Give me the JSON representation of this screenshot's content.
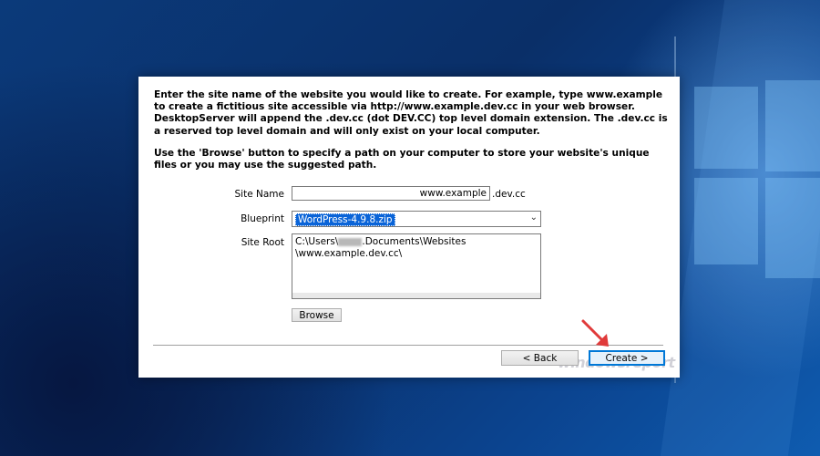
{
  "dialog": {
    "intro_paragraph": "Enter the site name of the website you would like to create. For example, type www.example to create a fictitious site accessible via http://www.example.dev.cc in your web browser. DesktopServer will append the .dev.cc (dot DEV.CC) top level domain extension. The .dev.cc is a reserved top level domain and will only exist on your local computer.",
    "browse_paragraph": "Use the 'Browse' button to specify a path on your computer to store your website's unique files or you may use the suggested path.",
    "site_name": {
      "label": "Site Name",
      "value": "www.example",
      "suffix": ".dev.cc"
    },
    "blueprint": {
      "label": "Blueprint",
      "selected": "WordPress-4.9.8.zip"
    },
    "site_root": {
      "label": "Site Root",
      "prefix": "C:\\Users\\",
      "suffix_line1": ".Documents\\Websites",
      "line2": "\\www.example.dev.cc\\"
    },
    "buttons": {
      "browse": "Browse",
      "back": "< Back",
      "create": "Create >"
    }
  },
  "watermark": "windowsreport",
  "colors": {
    "selection": "#0a64d8",
    "default_button_border": "#0078d7",
    "arrow": "#e03a3a"
  }
}
